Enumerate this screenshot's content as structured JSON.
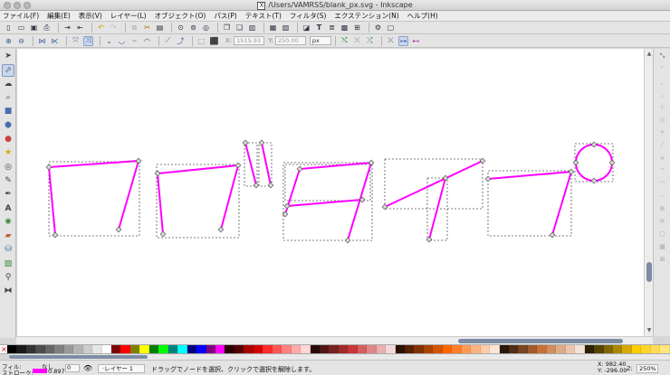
{
  "window": {
    "title": "/Users/VAMRSS/blank_px.svg - Inkscape",
    "title_icon": "X"
  },
  "menu": [
    "ファイル(F)",
    "編集(E)",
    "表示(V)",
    "レイヤー(L)",
    "オブジェクト(O)",
    "パス(P)",
    "テキスト(T)",
    "フィルタ(S)",
    "エクステンション(N)",
    "ヘルプ(H)"
  ],
  "node_toolbar": {
    "x_label": "X:",
    "x_value": "1515.93",
    "y_label": "Y:",
    "y_value": "250.00",
    "unit": "px"
  },
  "status": {
    "fill_label": "フィル:",
    "fill_value": "なし",
    "stroke_label": "ストローク:",
    "stroke_width": "0.897",
    "stroke_color": "#ff00ff",
    "opacity_value": "0",
    "layer": "·レイヤー 1",
    "message": "ドラッグでノードを選択、クリックで選択を解除します。",
    "cursor_x": "982.40",
    "cursor_y": "-296.00",
    "x_label": "X:",
    "y_label": "Y:",
    "zoom_label": "Z:",
    "zoom": "250%"
  },
  "colors": {
    "path_stroke": "#ff00ff",
    "bbox_dash": "#555555",
    "node_fill": "#dddddd"
  }
}
